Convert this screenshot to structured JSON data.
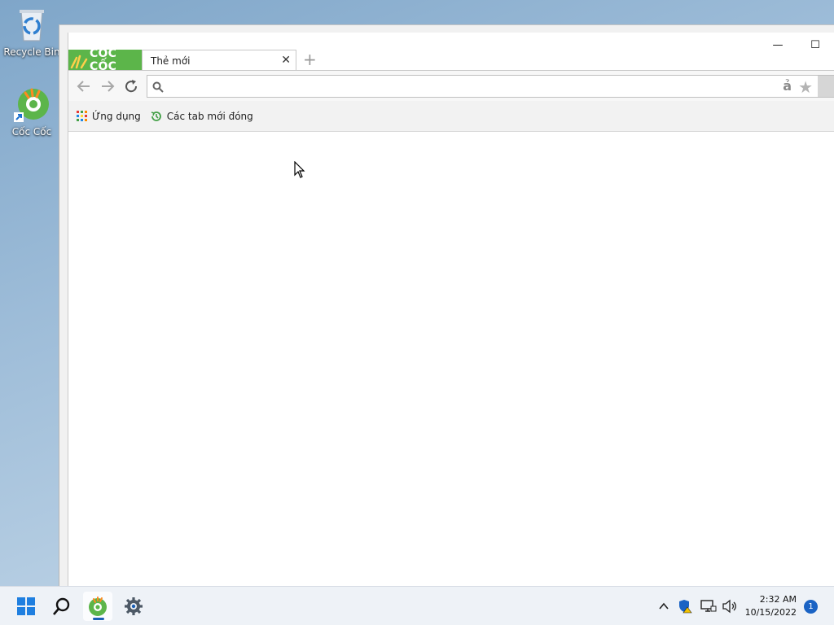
{
  "desktop": {
    "icons": [
      {
        "label": "Recycle Bin",
        "icon": "recycle-bin-icon"
      },
      {
        "label": "Cốc Cốc",
        "icon": "coccoc-icon"
      }
    ]
  },
  "browser": {
    "brand_label": "CỐC CỐC",
    "tab": {
      "title": "Thẻ mới"
    },
    "controls": {
      "minimize": "—",
      "maximize": "☐"
    },
    "omnibox": {
      "value": "",
      "placeholder": ""
    },
    "translate_glyph": "ả",
    "bookmarks": [
      {
        "label": "Ứng dụng",
        "icon": "apps-grid-icon"
      },
      {
        "label": "Các tab mới đóng",
        "icon": "history-icon"
      }
    ],
    "colors": {
      "brand": "#5cb54a",
      "accent": "#1a5fb4"
    }
  },
  "taskbar": {
    "clock_time": "2:32 AM",
    "clock_date": "10/15/2022",
    "notification_count": "1",
    "pinned": [
      "start-icon",
      "search-icon",
      "coccoc-icon",
      "settings-icon"
    ],
    "tray": [
      "chevron-up-icon",
      "security-icon",
      "network-icon",
      "volume-icon"
    ]
  }
}
